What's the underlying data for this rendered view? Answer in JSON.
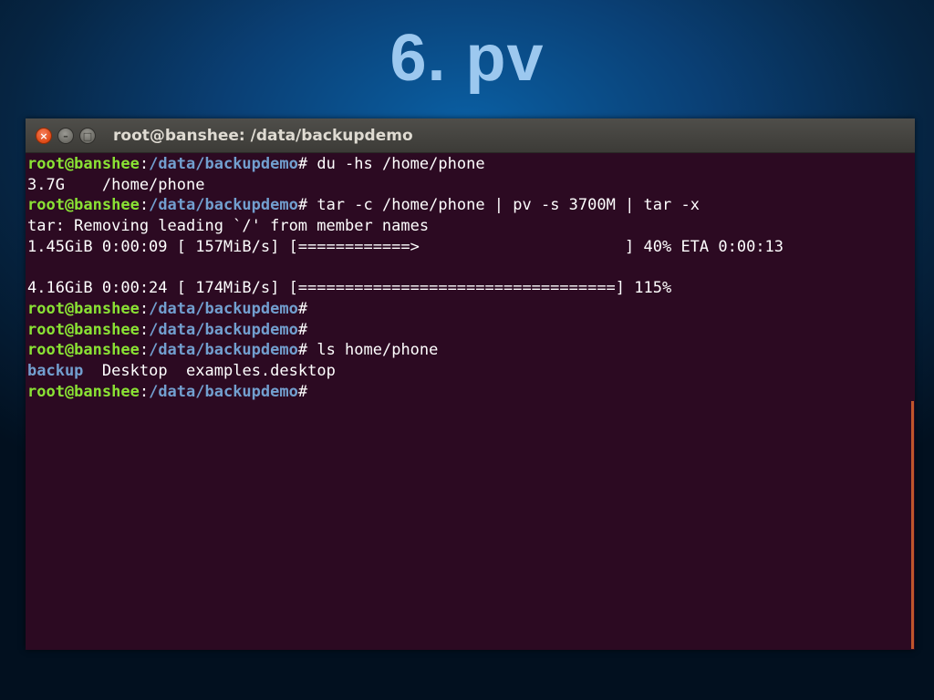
{
  "slide": {
    "title": "6. pv"
  },
  "window": {
    "title": "root@banshee: /data/backupdemo",
    "buttons": {
      "close": "×",
      "minimize": "–",
      "maximize": "□"
    }
  },
  "prompt": {
    "user": "root@banshee",
    "path": "/data/backupdemo"
  },
  "terminal": {
    "lines": [
      {
        "type": "prompt",
        "cmd": "du -hs /home/phone"
      },
      {
        "type": "output",
        "text": "3.7G    /home/phone"
      },
      {
        "type": "prompt",
        "cmd": "tar -c /home/phone | pv -s 3700M | tar -x"
      },
      {
        "type": "output",
        "text": "tar: Removing leading `/' from member names"
      },
      {
        "type": "output",
        "text": "1.45GiB 0:00:09 [ 157MiB/s] [============>                      ] 40% ETA 0:00:13"
      },
      {
        "type": "output",
        "text": ""
      },
      {
        "type": "output",
        "text": "4.16GiB 0:00:24 [ 174MiB/s] [==================================] 115%"
      },
      {
        "type": "prompt",
        "cmd": ""
      },
      {
        "type": "prompt",
        "cmd": ""
      },
      {
        "type": "prompt",
        "cmd": "ls home/phone"
      },
      {
        "type": "listing",
        "items": [
          {
            "name": "backup",
            "kind": "dir"
          },
          {
            "name": "Desktop",
            "kind": "file"
          },
          {
            "name": "examples.desktop",
            "kind": "file"
          }
        ]
      },
      {
        "type": "prompt",
        "cmd": ""
      }
    ]
  },
  "colors": {
    "terminal_bg": "#2c0a22",
    "prompt_user": "#8ae234",
    "prompt_path": "#729fcf",
    "directory": "#729fcf",
    "close_button": "#df4a16"
  }
}
